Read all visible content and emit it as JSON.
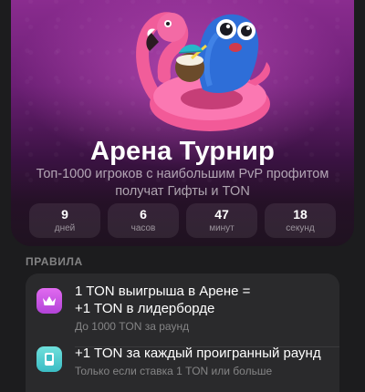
{
  "header": {
    "title": "Арена Турнир",
    "subtitle_line1": "Топ-1000 игроков с наибольшим PvP профитом",
    "subtitle_line2": "получат Гифты и TON",
    "sticker_icon": "flamingo-float-frog-sticker"
  },
  "timer": [
    {
      "value": "9",
      "unit": "дней"
    },
    {
      "value": "6",
      "unit": "часов"
    },
    {
      "value": "47",
      "unit": "минут"
    },
    {
      "value": "18",
      "unit": "секунд"
    }
  ],
  "rules": {
    "heading": "ПРАВИЛА",
    "items": [
      {
        "icon": "crown-icon",
        "line1": "1 TON выигрыша в Арене =",
        "line2": "+1 TON в лидерборде",
        "note": "До 1000 TON за раунд",
        "color": "#c851e0"
      },
      {
        "icon": "phone-icon",
        "line1": "+1 TON за каждый проигранный раунд",
        "note": "Только если ставка 1 TON или больше",
        "color": "#4fcfd2"
      }
    ]
  }
}
